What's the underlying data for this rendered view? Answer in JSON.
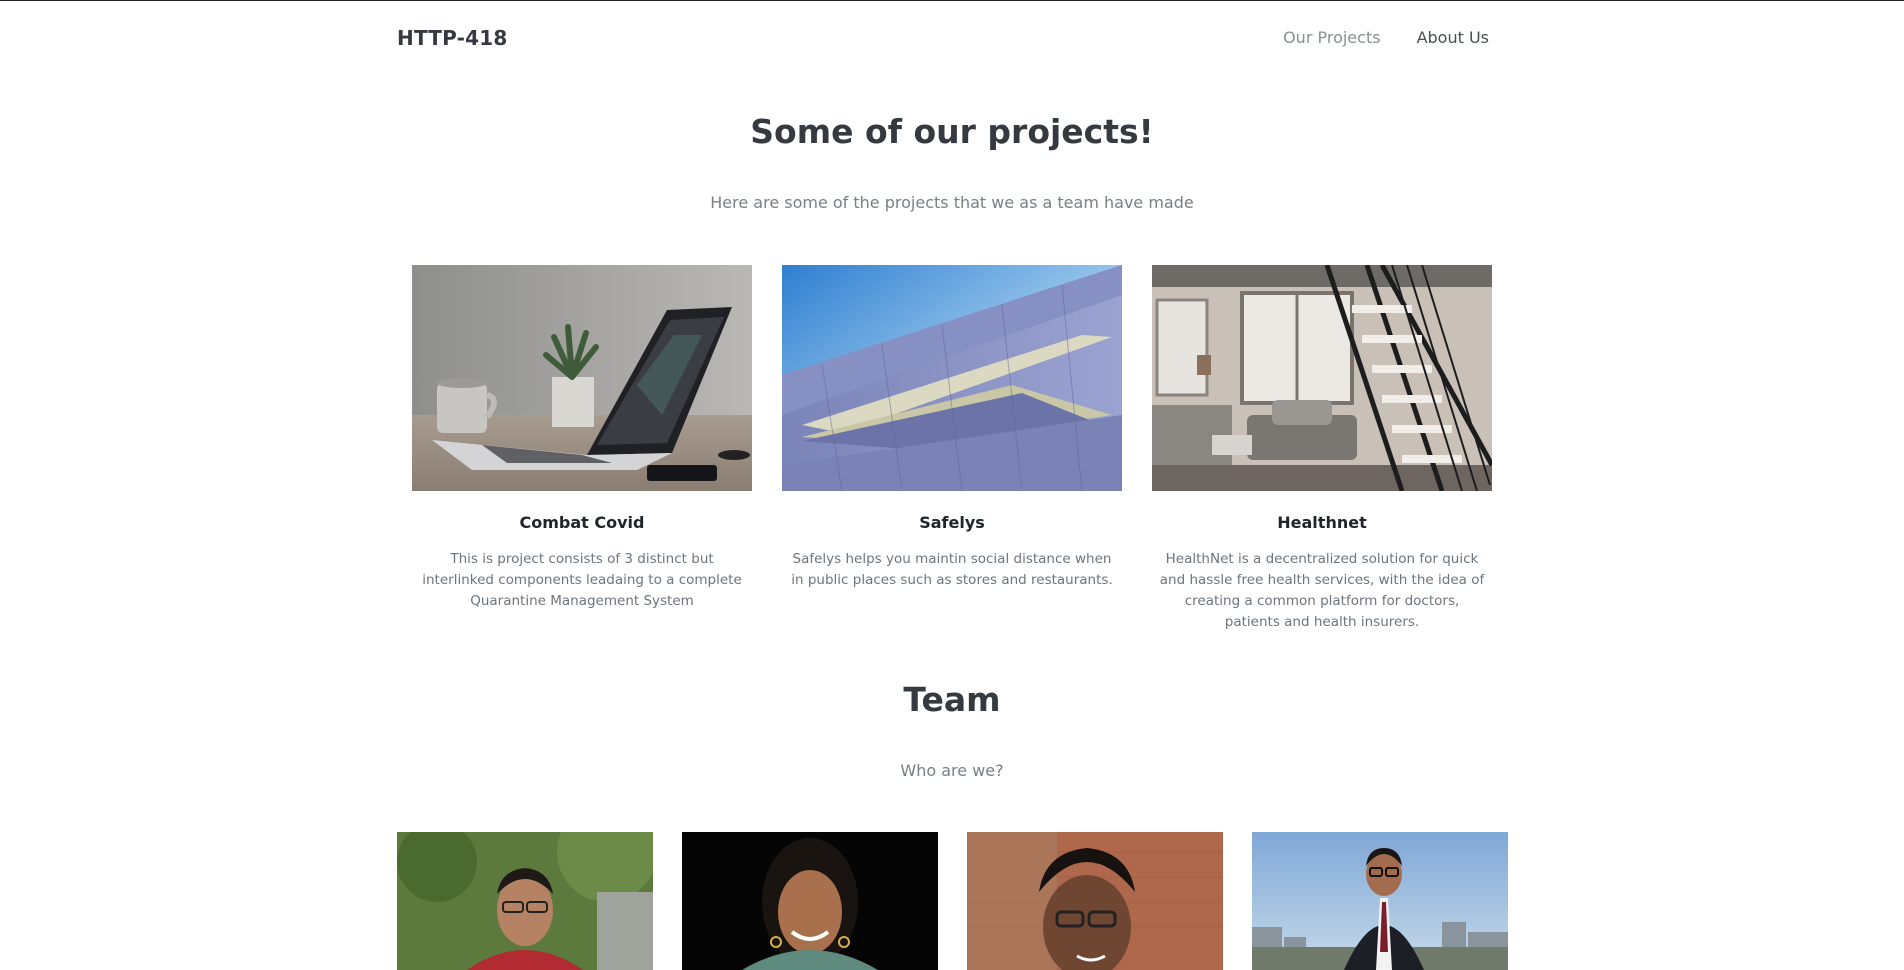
{
  "navbar": {
    "brand": "HTTP-418",
    "links": [
      "Our Projects",
      "About Us"
    ]
  },
  "projects_section": {
    "title": "Some of our projects!",
    "subtitle": "Here are some of the projects that we as a team have made",
    "cards": [
      {
        "title": "Combat Covid",
        "text": "This is project consists of 3 distinct but interlinked components leadaing to a complete Quarantine Management System",
        "image": "laptop-desk-photo"
      },
      {
        "title": "Safelys",
        "text": "Safelys helps you maintin social distance when in public places such as stores and restaurants.",
        "image": "building-facade-photo"
      },
      {
        "title": "Healthnet",
        "text": "HealthNet is a decentralized solution for quick and hassle free health services, with the idea of creating a common platform for doctors, patients and health insurers.",
        "image": "loft-interior-photo"
      }
    ]
  },
  "team_section": {
    "title": "Team",
    "subtitle": "Who are we?",
    "members": [
      {
        "image": "member-photo-1"
      },
      {
        "image": "member-photo-2"
      },
      {
        "image": "member-photo-3"
      },
      {
        "image": "member-photo-4"
      }
    ]
  }
}
